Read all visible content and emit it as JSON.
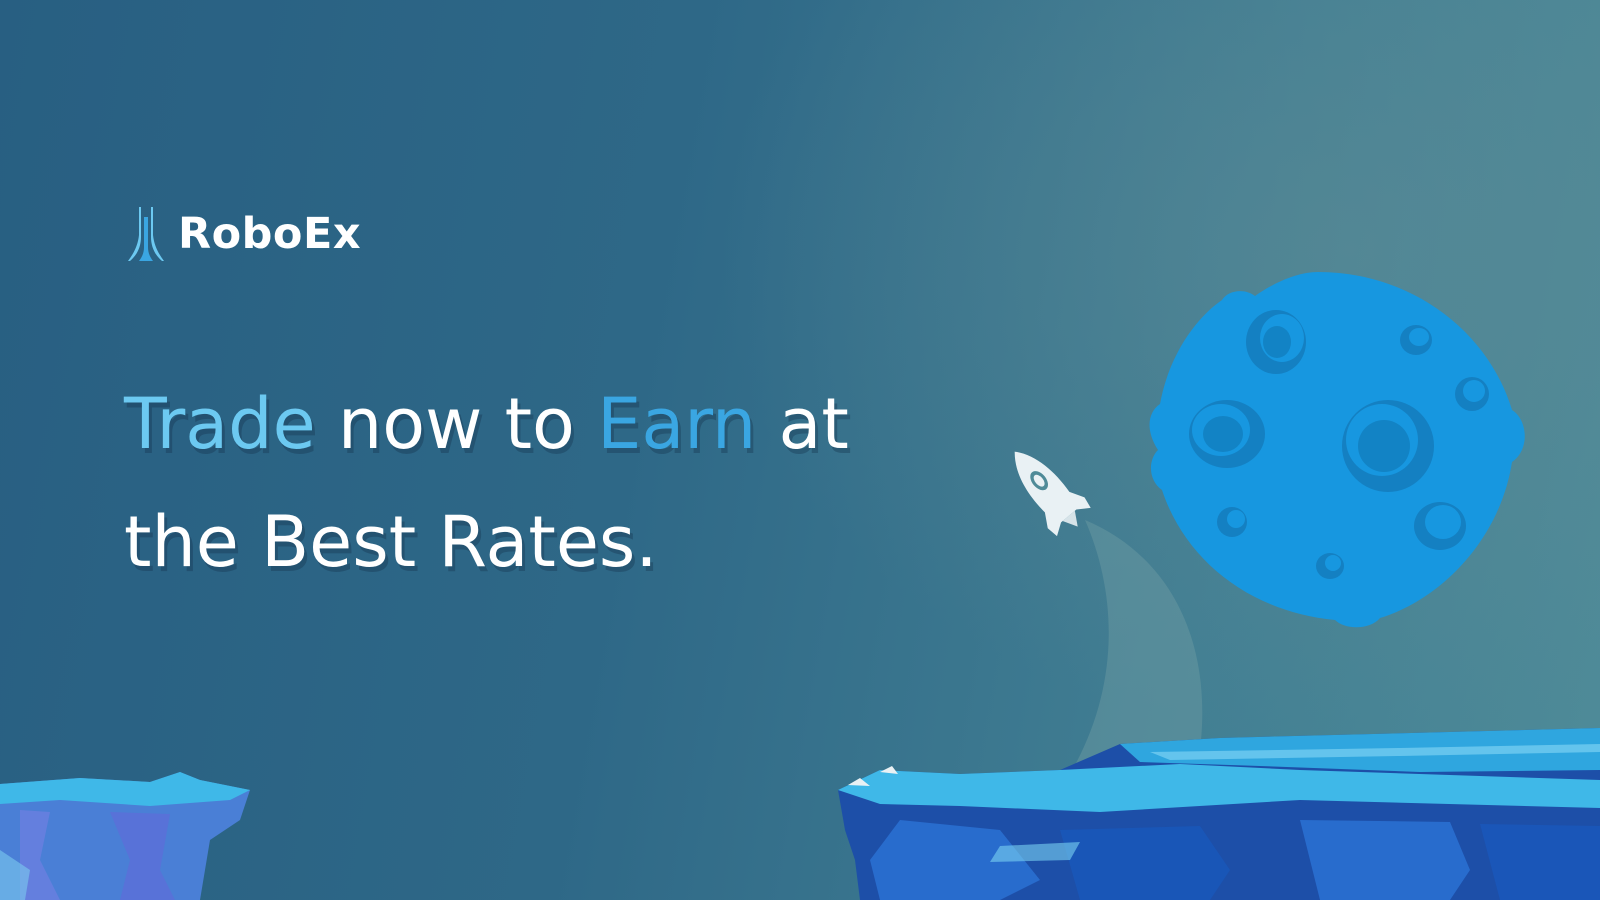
{
  "brand": {
    "name": "RoboEx"
  },
  "headline": {
    "word1": "Trade",
    "word2": " now to ",
    "word3": "Earn",
    "word4": " at",
    "line2": "the Best Rates."
  },
  "colors": {
    "background_left": "#285f82",
    "background_right": "#4f8b98",
    "accent_light": "#6cc9f1",
    "accent_medium": "#3aa6e2",
    "moon": "#1797e0",
    "ice_top": "#3fb8e8",
    "ice_side": "#1d4fa8"
  },
  "illustration": {
    "logo_icon": "tower-icon",
    "rocket_icon": "rocket-icon",
    "moon_icon": "moon-icon",
    "ice_icon": "ice-cliff-icon"
  }
}
